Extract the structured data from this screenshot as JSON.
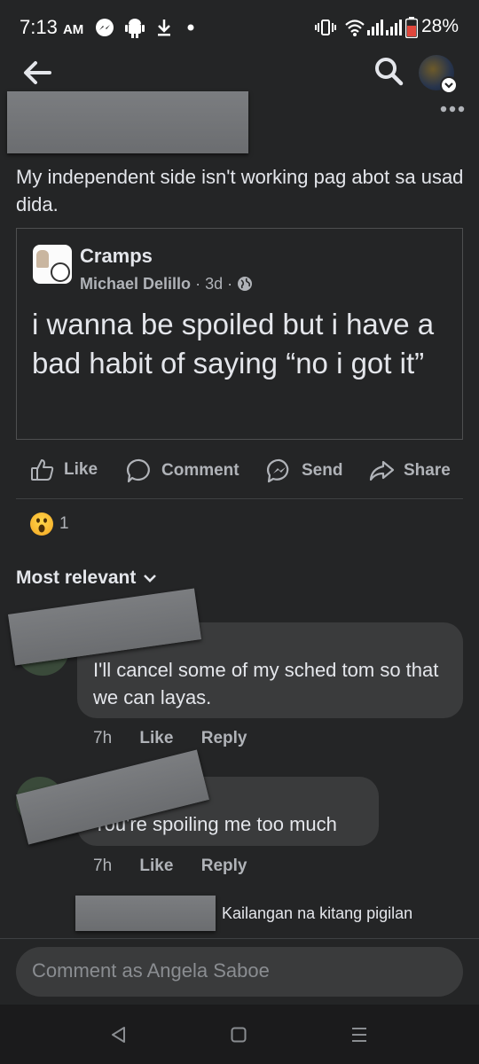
{
  "status_bar": {
    "time": "7:13",
    "ampm": "AM",
    "battery": "28%",
    "icons": [
      "messenger-icon",
      "android-icon",
      "download-icon",
      "dot-icon",
      "vibrate-icon",
      "wifi-icon",
      "signal-icon",
      "battery-icon"
    ]
  },
  "header": {
    "icons": [
      "back-arrow-icon",
      "search-icon",
      "profile-avatar",
      "more-icon"
    ]
  },
  "post": {
    "text": "My independent side isn't working pag abot sa usad dida."
  },
  "shared": {
    "group": "Cramps",
    "author": "Michael Delillo",
    "separator": "·",
    "age": "3d",
    "sep2": "·",
    "body": "i wanna be spoiled but i have a bad habit of saying “no i got it”"
  },
  "actions": {
    "like": "Like",
    "comment": "Comment",
    "send": "Send",
    "share": "Share"
  },
  "reactions": {
    "count": "1",
    "emoji": "wow-emoji"
  },
  "comments_header": {
    "label": "Most relevant"
  },
  "comments": [
    {
      "text": "I'll cancel some of my sched tom so that we can layas.",
      "time": "7h",
      "like": "Like",
      "reply": "Reply"
    },
    {
      "text": "You're spoiling me too much",
      "time": "7h",
      "like": "Like",
      "reply": "Reply"
    }
  ],
  "reply_preview": {
    "text": "Kailangan na kitang pigilan"
  },
  "composer": {
    "placeholder": "Comment as Angela Saboe"
  },
  "colors": {
    "background": "#242526",
    "bubble": "#3a3b3c",
    "text": "#e4e6eb",
    "secondary": "#b0b3b8",
    "accent": "#2d88ff"
  }
}
